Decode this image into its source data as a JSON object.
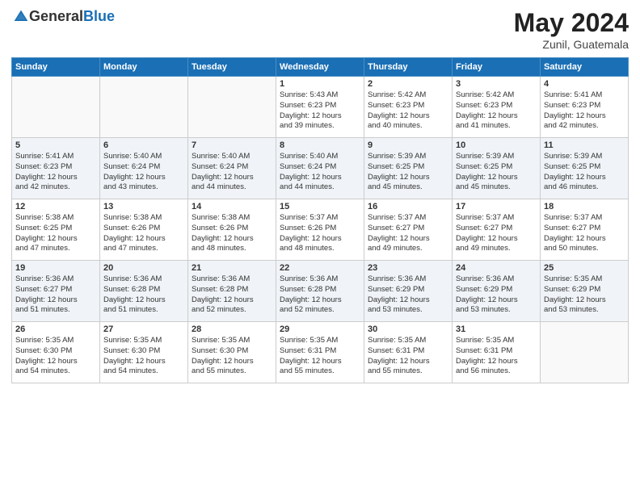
{
  "header": {
    "logo_general": "General",
    "logo_blue": "Blue",
    "month": "May 2024",
    "location": "Zunil, Guatemala"
  },
  "days_of_week": [
    "Sunday",
    "Monday",
    "Tuesday",
    "Wednesday",
    "Thursday",
    "Friday",
    "Saturday"
  ],
  "weeks": [
    [
      {
        "day": "",
        "content": ""
      },
      {
        "day": "",
        "content": ""
      },
      {
        "day": "",
        "content": ""
      },
      {
        "day": "1",
        "content": "Sunrise: 5:43 AM\nSunset: 6:23 PM\nDaylight: 12 hours\nand 39 minutes."
      },
      {
        "day": "2",
        "content": "Sunrise: 5:42 AM\nSunset: 6:23 PM\nDaylight: 12 hours\nand 40 minutes."
      },
      {
        "day": "3",
        "content": "Sunrise: 5:42 AM\nSunset: 6:23 PM\nDaylight: 12 hours\nand 41 minutes."
      },
      {
        "day": "4",
        "content": "Sunrise: 5:41 AM\nSunset: 6:23 PM\nDaylight: 12 hours\nand 42 minutes."
      }
    ],
    [
      {
        "day": "5",
        "content": "Sunrise: 5:41 AM\nSunset: 6:23 PM\nDaylight: 12 hours\nand 42 minutes."
      },
      {
        "day": "6",
        "content": "Sunrise: 5:40 AM\nSunset: 6:24 PM\nDaylight: 12 hours\nand 43 minutes."
      },
      {
        "day": "7",
        "content": "Sunrise: 5:40 AM\nSunset: 6:24 PM\nDaylight: 12 hours\nand 44 minutes."
      },
      {
        "day": "8",
        "content": "Sunrise: 5:40 AM\nSunset: 6:24 PM\nDaylight: 12 hours\nand 44 minutes."
      },
      {
        "day": "9",
        "content": "Sunrise: 5:39 AM\nSunset: 6:25 PM\nDaylight: 12 hours\nand 45 minutes."
      },
      {
        "day": "10",
        "content": "Sunrise: 5:39 AM\nSunset: 6:25 PM\nDaylight: 12 hours\nand 45 minutes."
      },
      {
        "day": "11",
        "content": "Sunrise: 5:39 AM\nSunset: 6:25 PM\nDaylight: 12 hours\nand 46 minutes."
      }
    ],
    [
      {
        "day": "12",
        "content": "Sunrise: 5:38 AM\nSunset: 6:25 PM\nDaylight: 12 hours\nand 47 minutes."
      },
      {
        "day": "13",
        "content": "Sunrise: 5:38 AM\nSunset: 6:26 PM\nDaylight: 12 hours\nand 47 minutes."
      },
      {
        "day": "14",
        "content": "Sunrise: 5:38 AM\nSunset: 6:26 PM\nDaylight: 12 hours\nand 48 minutes."
      },
      {
        "day": "15",
        "content": "Sunrise: 5:37 AM\nSunset: 6:26 PM\nDaylight: 12 hours\nand 48 minutes."
      },
      {
        "day": "16",
        "content": "Sunrise: 5:37 AM\nSunset: 6:27 PM\nDaylight: 12 hours\nand 49 minutes."
      },
      {
        "day": "17",
        "content": "Sunrise: 5:37 AM\nSunset: 6:27 PM\nDaylight: 12 hours\nand 49 minutes."
      },
      {
        "day": "18",
        "content": "Sunrise: 5:37 AM\nSunset: 6:27 PM\nDaylight: 12 hours\nand 50 minutes."
      }
    ],
    [
      {
        "day": "19",
        "content": "Sunrise: 5:36 AM\nSunset: 6:27 PM\nDaylight: 12 hours\nand 51 minutes."
      },
      {
        "day": "20",
        "content": "Sunrise: 5:36 AM\nSunset: 6:28 PM\nDaylight: 12 hours\nand 51 minutes."
      },
      {
        "day": "21",
        "content": "Sunrise: 5:36 AM\nSunset: 6:28 PM\nDaylight: 12 hours\nand 52 minutes."
      },
      {
        "day": "22",
        "content": "Sunrise: 5:36 AM\nSunset: 6:28 PM\nDaylight: 12 hours\nand 52 minutes."
      },
      {
        "day": "23",
        "content": "Sunrise: 5:36 AM\nSunset: 6:29 PM\nDaylight: 12 hours\nand 53 minutes."
      },
      {
        "day": "24",
        "content": "Sunrise: 5:36 AM\nSunset: 6:29 PM\nDaylight: 12 hours\nand 53 minutes."
      },
      {
        "day": "25",
        "content": "Sunrise: 5:35 AM\nSunset: 6:29 PM\nDaylight: 12 hours\nand 53 minutes."
      }
    ],
    [
      {
        "day": "26",
        "content": "Sunrise: 5:35 AM\nSunset: 6:30 PM\nDaylight: 12 hours\nand 54 minutes."
      },
      {
        "day": "27",
        "content": "Sunrise: 5:35 AM\nSunset: 6:30 PM\nDaylight: 12 hours\nand 54 minutes."
      },
      {
        "day": "28",
        "content": "Sunrise: 5:35 AM\nSunset: 6:30 PM\nDaylight: 12 hours\nand 55 minutes."
      },
      {
        "day": "29",
        "content": "Sunrise: 5:35 AM\nSunset: 6:31 PM\nDaylight: 12 hours\nand 55 minutes."
      },
      {
        "day": "30",
        "content": "Sunrise: 5:35 AM\nSunset: 6:31 PM\nDaylight: 12 hours\nand 55 minutes."
      },
      {
        "day": "31",
        "content": "Sunrise: 5:35 AM\nSunset: 6:31 PM\nDaylight: 12 hours\nand 56 minutes."
      },
      {
        "day": "",
        "content": ""
      }
    ]
  ]
}
